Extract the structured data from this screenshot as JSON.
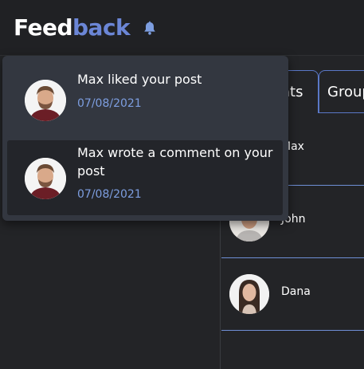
{
  "header": {
    "logo_part1": "Feed",
    "logo_part2": "back",
    "bell_icon": "bell-icon"
  },
  "colors": {
    "background": "#232427",
    "accent": "#6b86d6",
    "date": "#7d9ee0",
    "dropdown": "#333740"
  },
  "tabs": [
    {
      "label": "Chats"
    },
    {
      "label": "Groups"
    }
  ],
  "chats": [
    {
      "name": "Max",
      "avatar": "avatar-max"
    },
    {
      "name": "John",
      "avatar": "avatar-john"
    },
    {
      "name": "Dana",
      "avatar": "avatar-dana"
    }
  ],
  "notifications": [
    {
      "text": "Max liked your post",
      "date": "07/08/2021"
    },
    {
      "text": "Max wrote a comment on your post",
      "date": "07/08/2021"
    }
  ]
}
